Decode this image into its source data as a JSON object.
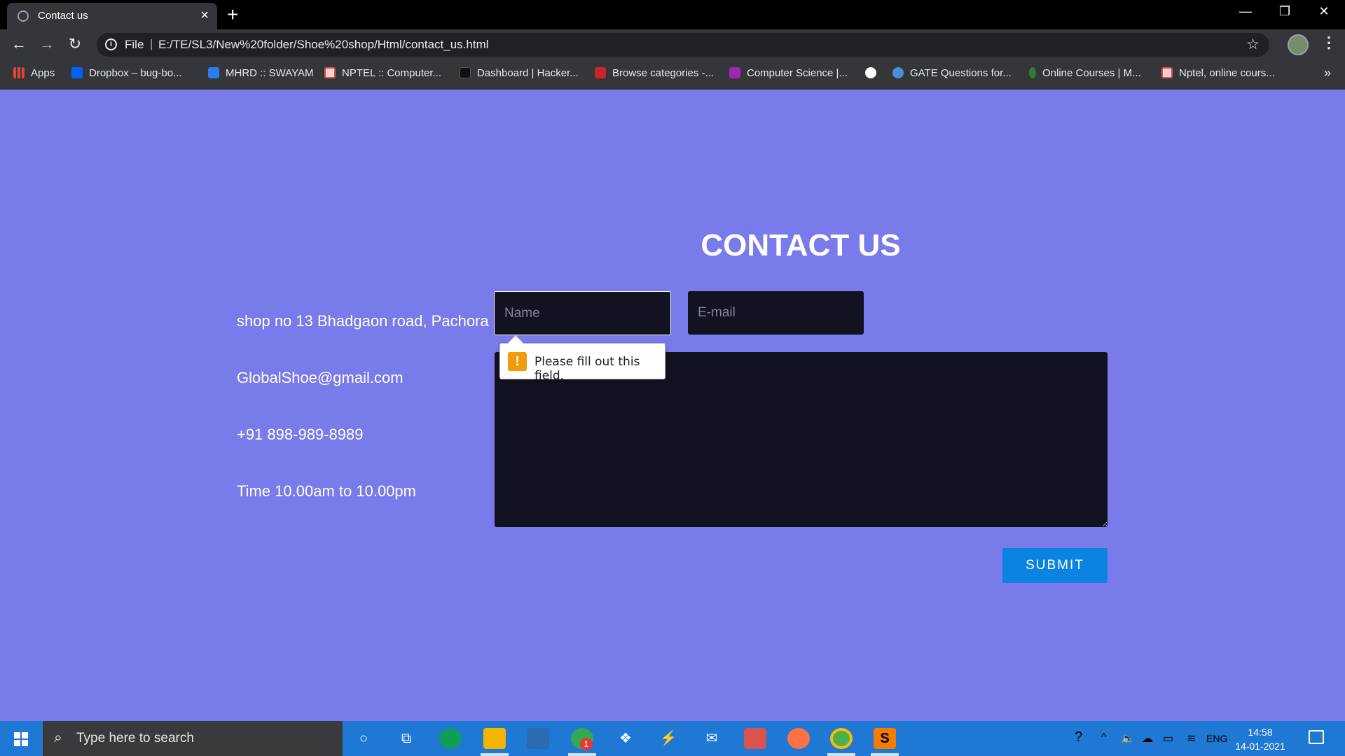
{
  "browser": {
    "tab": {
      "title": "Contact us",
      "close_icon": "×"
    },
    "new_tab_icon": "+",
    "window_controls": {
      "minimize": "—",
      "restore": "❐",
      "close": "✕"
    },
    "nav": {
      "back": "←",
      "forward": "→",
      "reload": "↻"
    },
    "address": {
      "scheme": "File",
      "separator": "|",
      "url": "E:/TE/SL3/New%20folder/Shoe%20shop/Html/contact_us.html"
    },
    "bookmarks": [
      {
        "label": "Apps",
        "icon": "apps-grid-icon",
        "color": "#ea4335"
      },
      {
        "label": "Dropbox – bug-bo...",
        "icon": "dropbox-icon",
        "color": "#0061fe"
      },
      {
        "label": "MHRD :: SWAYAM",
        "icon": "swayam-icon",
        "color": "#2b7de9"
      },
      {
        "label": "NPTEL :: Computer...",
        "icon": "nptel-icon",
        "color": "#d9534f"
      },
      {
        "label": "Dashboard | Hacker...",
        "icon": "hackerrank-icon",
        "color": "#111111"
      },
      {
        "label": "Browse categories -...",
        "icon": "geeks-icon",
        "color": "#c62828"
      },
      {
        "label": "Computer Science |...",
        "icon": "g-icon",
        "color": "#9c27b0"
      },
      {
        "label": "",
        "icon": "globe-icon",
        "color": "#ffffff"
      },
      {
        "label": "GATE Questions for...",
        "icon": "gate-icon",
        "color": "#4a90d9"
      },
      {
        "label": "Online Courses | M...",
        "icon": "leaf-icon",
        "color": "#2e7d32"
      },
      {
        "label": "Nptel, online cours...",
        "icon": "nptel-icon",
        "color": "#d9534f"
      }
    ],
    "bookmarks_more": "»"
  },
  "page": {
    "heading": "CONTACT US",
    "info": {
      "address": "shop no 13 Bhadgaon road, Pachora",
      "email": "GlobalShoe@gmail.com",
      "phone": "+91 898-989-8989",
      "hours": "Time 10.00am to 10.00pm"
    },
    "form": {
      "name_placeholder": "Name",
      "email_placeholder": "E-mail",
      "submit_label": "SUBMIT"
    },
    "validation_message": "Please fill out this field.",
    "validation_icon": "!"
  },
  "taskbar": {
    "search_placeholder": "Type here to search",
    "search_icon": "⌕",
    "tray": {
      "language": "ENG",
      "time": "14:58",
      "date": "14-01-2021"
    },
    "badge_count": "1"
  },
  "colors": {
    "page_background": "#787be9",
    "input_background": "#121220",
    "submit_button": "#0a84e0",
    "taskbar": "#1e78d4"
  }
}
